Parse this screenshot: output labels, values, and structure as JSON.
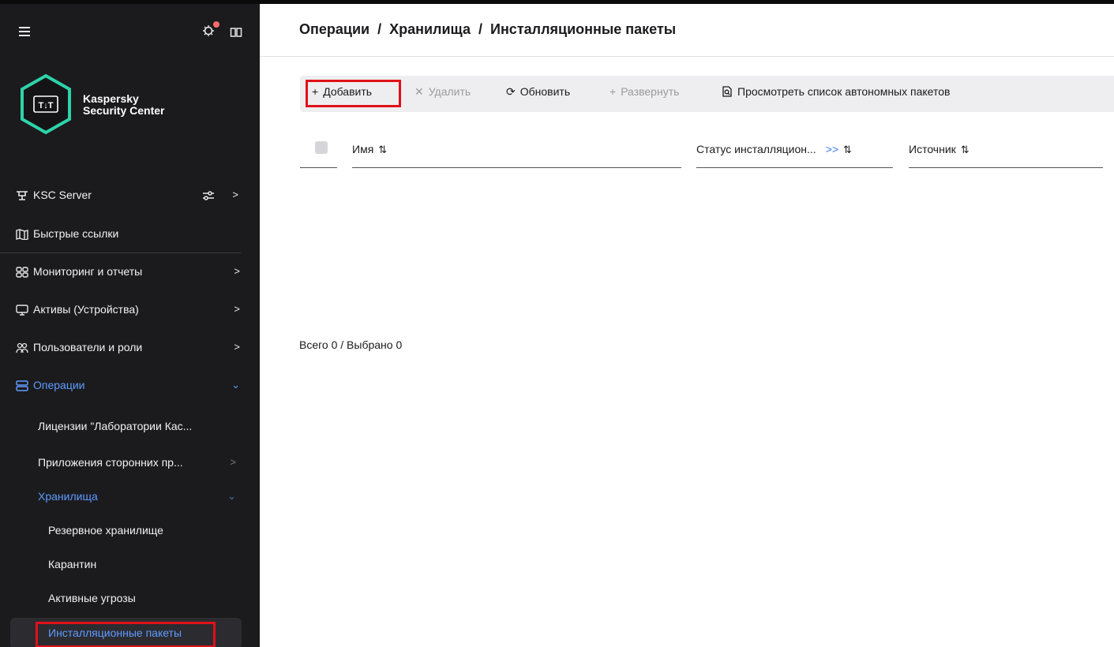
{
  "sidebar": {
    "app_name_line1": "Kaspersky",
    "app_name_line2": "Security Center",
    "logo_letters": "T↓T",
    "nav": {
      "server": "KSC Server",
      "quick_links": "Быстрые ссылки",
      "monitoring": "Мониторинг и отчеты",
      "assets": "Активы (Устройства)",
      "users": "Пользователи и роли",
      "operations": "Операции"
    },
    "sub": {
      "licenses": "Лицензии \"Лаборатории Кас...",
      "third_party": "Приложения сторонних пр...",
      "storage": "Хранилища",
      "backup": "Резервное хранилище",
      "quarantine": "Карантин",
      "threats": "Активные угрозы",
      "packages": "Инсталляционные пакеты"
    },
    "chevron_right": ">",
    "chevron_down": "⌄"
  },
  "main": {
    "breadcrumb": [
      "Операции",
      "Хранилища",
      "Инсталляционные пакеты"
    ],
    "breadcrumb_sep": "/",
    "toolbar": {
      "add": "Добавить",
      "delete": "Удалить",
      "refresh": "Обновить",
      "deploy": "Развернуть",
      "view_offline": "Просмотреть список автономных пакетов"
    },
    "table": {
      "columns": [
        "Имя",
        "Статус инсталляцион...",
        "Источник"
      ],
      "more": ">>",
      "sort_glyph": "⇅"
    },
    "footer": "Всего 0 / Выбрано 0"
  },
  "colors": {
    "sidebar_bg": "#1b1b1e",
    "accent_blue": "#5f9bff",
    "highlight_red": "#e0101a",
    "logo_teal": "#2dd4a8"
  }
}
